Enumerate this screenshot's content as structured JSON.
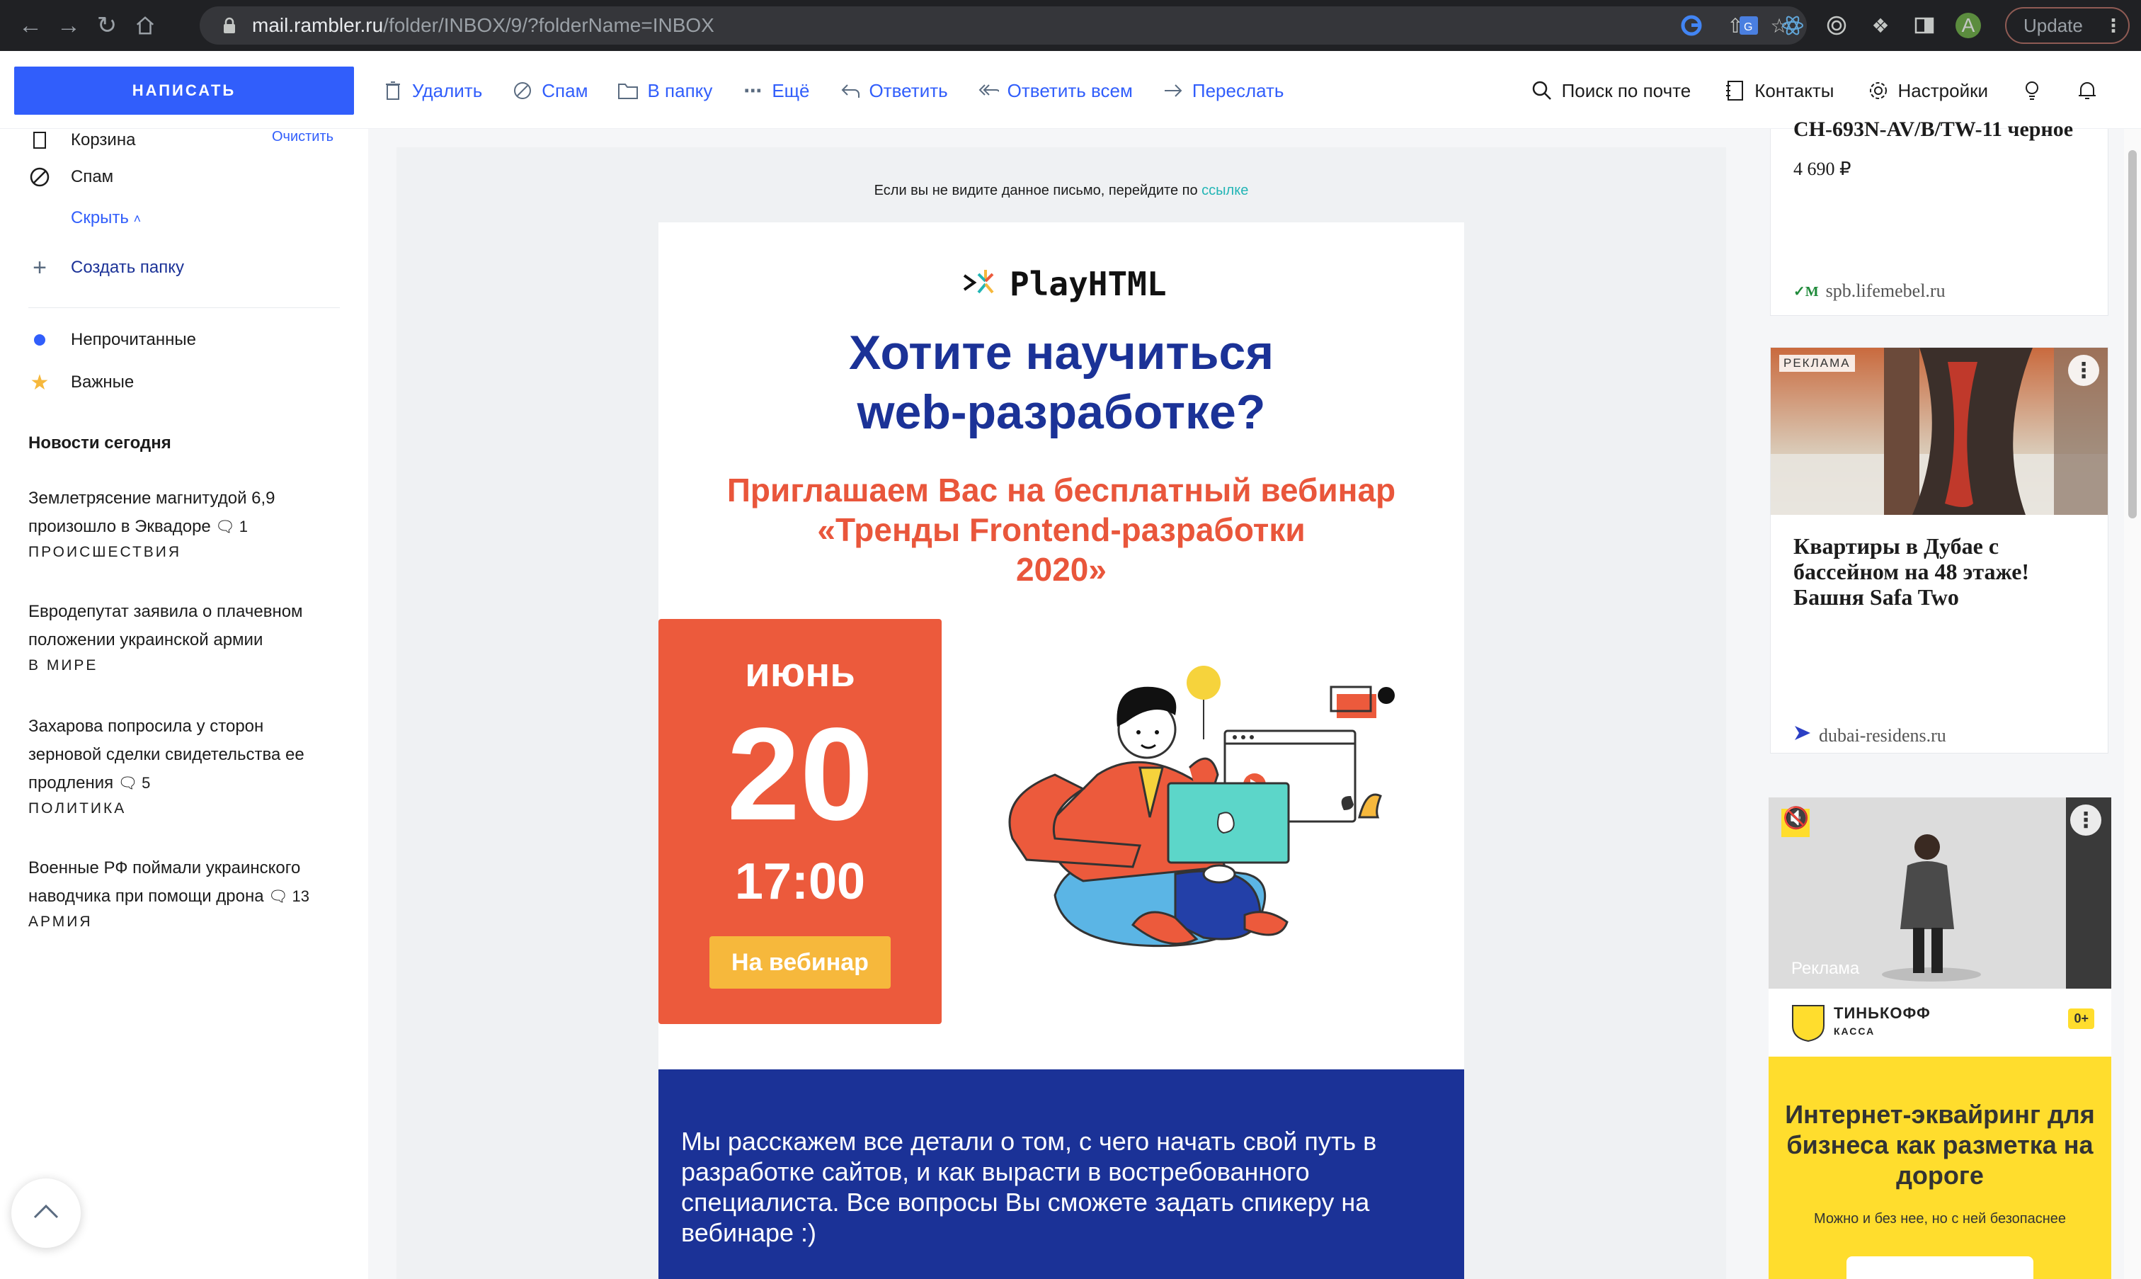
{
  "browser": {
    "url_host": "mail.rambler.ru",
    "url_path": "/folder/INBOX/9/?folderName=INBOX",
    "update_label": "Update",
    "profile_initial": "A"
  },
  "toolbar": {
    "compose_label": "НАПИСАТЬ",
    "actions": [
      "Удалить",
      "Спам",
      "В папку",
      "Ещё",
      "Ответить",
      "Ответить всем",
      "Переслать"
    ],
    "search_label": "Поиск по почте",
    "contacts_label": "Контакты",
    "settings_label": "Настройки"
  },
  "sidebar": {
    "trash_label": "Корзина",
    "clean_label": "Очистить",
    "spam_label": "Спам",
    "hide_label": "Скрыть",
    "create_folder_label": "Создать папку",
    "unread_label": "Непрочитанные",
    "important_label": "Важные",
    "news_title": "Новости сегодня",
    "news": [
      {
        "text": "Землетрясение магнитудой 6,9 произошло в Эквадоре",
        "comments": "1",
        "category": "ПРОИСШЕСТВИЯ"
      },
      {
        "text": "Евродепутат заявила о плачевном положении украинской армии",
        "comments": "",
        "category": "В МИРЕ"
      },
      {
        "text": "Захарова попросила у сторон зерновой сделки свидетельства ее продления",
        "comments": "5",
        "category": "ПОЛИТИКА"
      },
      {
        "text": "Военные РФ поймали украинского наводчика при помощи дрона",
        "comments": "13",
        "category": "АРМИЯ"
      }
    ]
  },
  "email": {
    "preheader_text": "Если вы не видите данное письмо, перейдите по",
    "preheader_link": "ссылке",
    "brand": "PlayHTML",
    "headline_1": "Хотите научиться",
    "headline_2": "web-разработке?",
    "subhead_1": "Приглашаем Вас на бесплатный вебинар",
    "subhead_2": "«Тренды Frontend-разработки",
    "subhead_3": "2020»",
    "month": "июнь",
    "day": "20",
    "time": "17:00",
    "cta": "На вебинар",
    "body_text": "Мы расскажем все детали о том, с чего начать свой путь в разработке сайтов, и как вырасти в востребованного специалиста. Все вопросы Вы сможете задать спикеру на вебинаре :)"
  },
  "ads": {
    "ad1_title": "СН-693N-AV/B/TW-11 черное",
    "ad1_price": "4 690 ₽",
    "ad1_source": "spb.lifemebel.ru",
    "ad2_tag": "РЕКЛАМА",
    "ad2_title": "Квартиры в Дубае с бассейном на 48 этаже! Башня Safa Two",
    "ad2_source": "dubai-residens.ru",
    "ad3_video_label": "Реклама",
    "ad3_brand": "ТИНЬКОФФ",
    "ad3_brand_sub": "КАССА",
    "ad3_age": "0+",
    "ad3_headline": "Интернет-эквайринг для бизнеса как разметка на дороге",
    "ad3_note": "Можно и без нее, но с ней безопаснее"
  },
  "colors": {
    "accent": "#315efb",
    "email_blue": "#1b3297",
    "email_red": "#ec5a3c",
    "cta_yellow": "#f6b83c",
    "tinkoff_yellow": "#ffdd2d"
  }
}
